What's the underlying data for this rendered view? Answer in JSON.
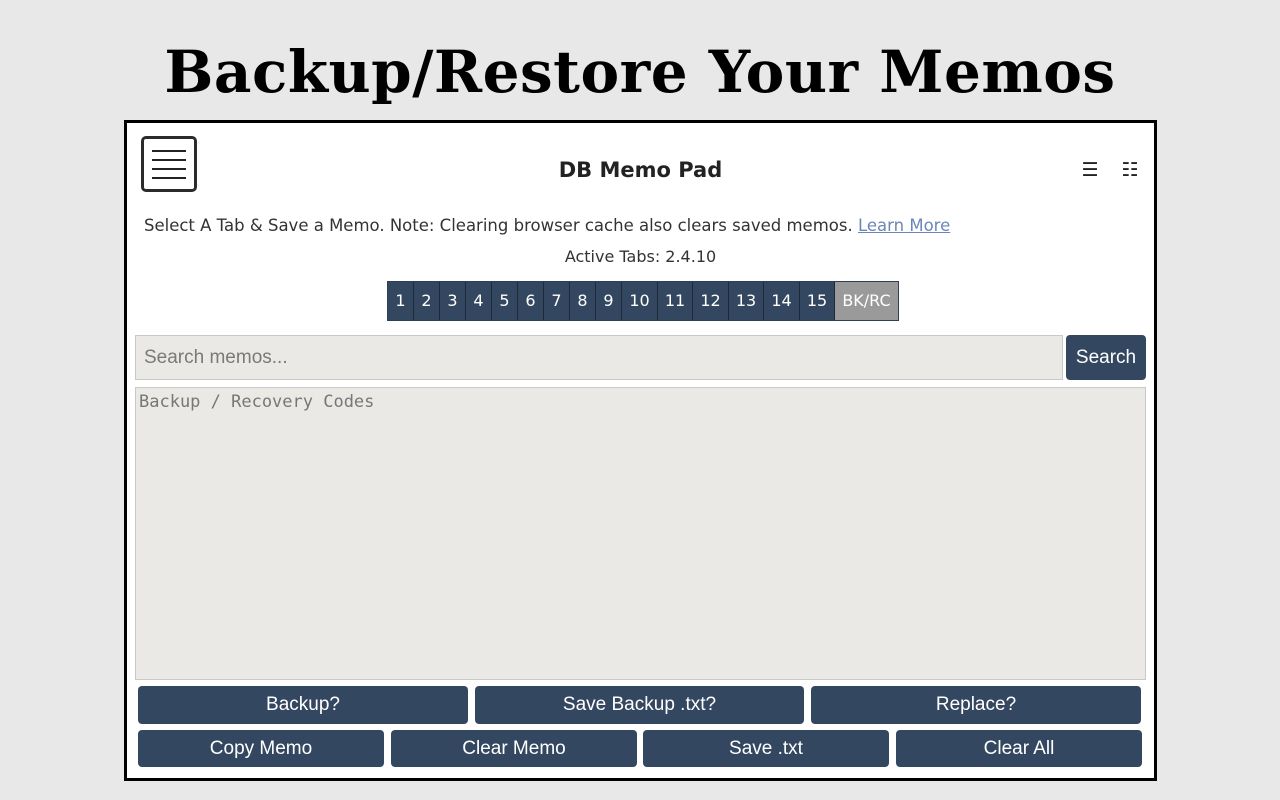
{
  "page": {
    "heading": "Backup/Restore Your Memos"
  },
  "app": {
    "title": "DB Memo Pad",
    "logo_icon": "notepad-icon",
    "header_icons": [
      {
        "name": "menu-icon",
        "glyph": "☰"
      },
      {
        "name": "grid-list-icon",
        "glyph": "☷"
      }
    ]
  },
  "notice": {
    "text": "Select A Tab & Save a Memo. Note: Clearing browser cache also clears saved memos.",
    "link_text": "Learn More"
  },
  "active_tabs": {
    "text": "Active Tabs: 2.4.10"
  },
  "tabs": [
    {
      "label": "1"
    },
    {
      "label": "2"
    },
    {
      "label": "3"
    },
    {
      "label": "4"
    },
    {
      "label": "5"
    },
    {
      "label": "6"
    },
    {
      "label": "7"
    },
    {
      "label": "8"
    },
    {
      "label": "9"
    },
    {
      "label": "10"
    },
    {
      "label": "11"
    },
    {
      "label": "12"
    },
    {
      "label": "13"
    },
    {
      "label": "14"
    },
    {
      "label": "15"
    },
    {
      "label": "BK/RC",
      "active": true
    }
  ],
  "search": {
    "placeholder": "Search memos...",
    "value": "",
    "button_label": "Search"
  },
  "memo": {
    "placeholder": "Backup / Recovery Codes",
    "value": ""
  },
  "actions_row1": {
    "backup": "Backup?",
    "save_backup": "Save Backup .txt?",
    "replace": "Replace?"
  },
  "actions_row2": {
    "copy_memo": "Copy Memo",
    "clear_memo": "Clear Memo",
    "save_txt": "Save .txt",
    "clear_all": "Clear All"
  },
  "colors": {
    "background": "#e8e8e8",
    "button": "#344760",
    "active_tab": "#9a9a9a",
    "link": "#6b86b8",
    "input_bg": "#ebe9e6"
  }
}
